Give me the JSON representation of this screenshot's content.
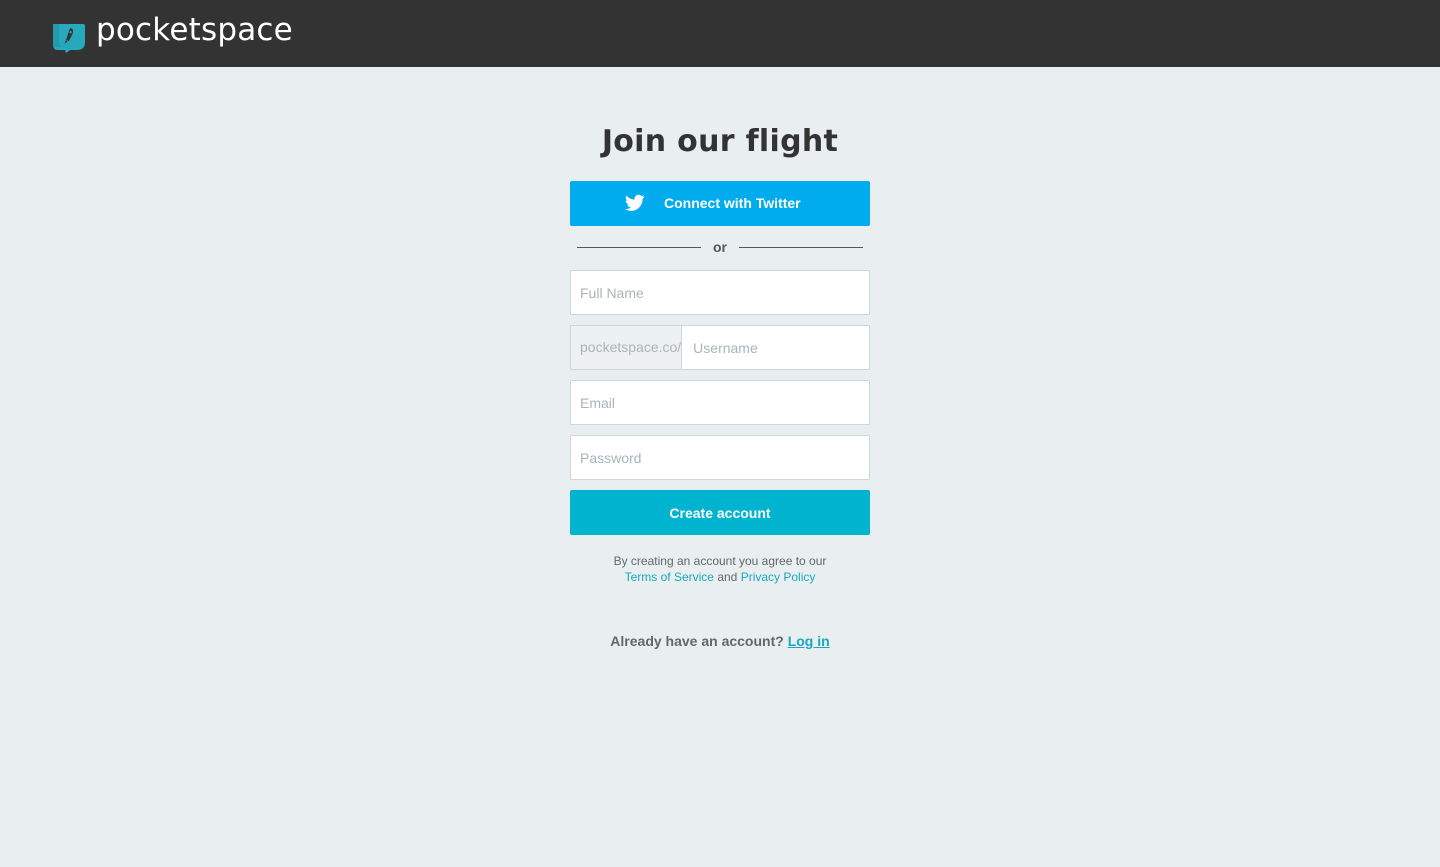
{
  "header": {
    "brand_name": "pocketspace",
    "logo_icon": "pocketspace-rocket-logo",
    "background_color": "#333333"
  },
  "signup": {
    "title": "Join our flight",
    "twitter_button": {
      "label": "Connect with Twitter",
      "icon": "twitter-bird-icon",
      "color": "#00acee"
    },
    "divider_text": "or",
    "fields": {
      "full_name": {
        "placeholder": "Full Name",
        "value": ""
      },
      "username_prefix": "pocketspace.co/",
      "username": {
        "placeholder": "Username",
        "value": ""
      },
      "email": {
        "placeholder": "Email",
        "value": ""
      },
      "password": {
        "placeholder": "Password",
        "value": ""
      }
    },
    "create_button": {
      "label": "Create account",
      "color": "#00b4d0"
    },
    "terms": {
      "prefix": "By creating an account you agree to our",
      "tos_link": "Terms of Service",
      "conjunction": "and",
      "privacy_link": "Privacy Policy"
    },
    "login": {
      "prompt": "Already have an account?",
      "link": "Log in"
    }
  },
  "colors": {
    "page_background": "#e9eff1",
    "accent_link": "#1aa8bf",
    "logo_teal": "#26a9bd"
  }
}
